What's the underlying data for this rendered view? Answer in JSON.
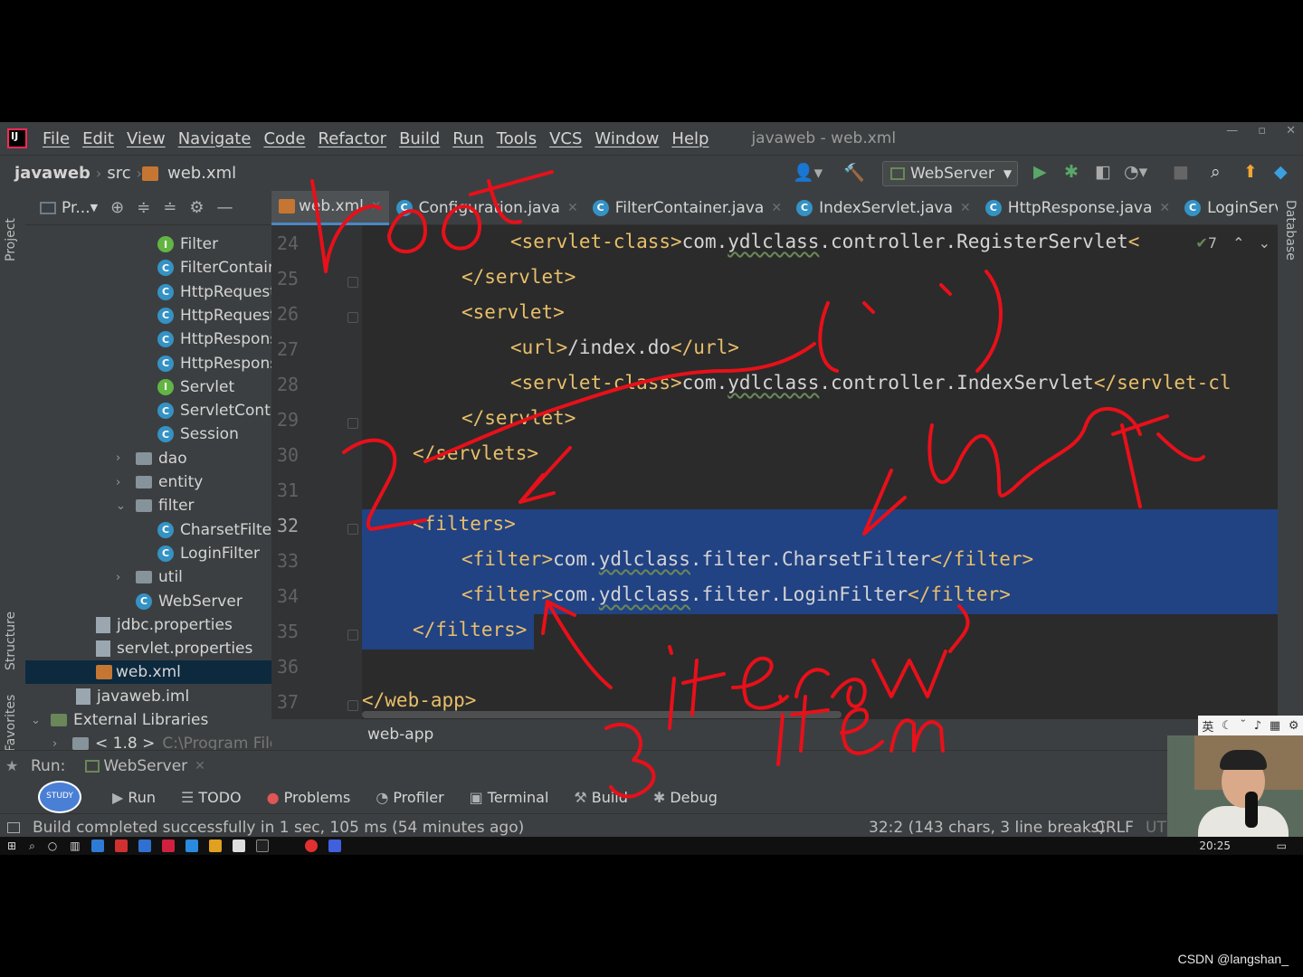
{
  "menubar": {
    "items": [
      "File",
      "Edit",
      "View",
      "Navigate",
      "Code",
      "Refactor",
      "Build",
      "Run",
      "Tools",
      "VCS",
      "Window",
      "Help"
    ],
    "title": "javaweb - web.xml"
  },
  "navbar": {
    "project": "javaweb",
    "src": "src",
    "file": "web.xml",
    "run_config": "WebServer"
  },
  "left_strip": {
    "project_tab": "Project",
    "structure_tab": "Structure",
    "favorites_tab": "Favorites"
  },
  "right_strip": {
    "database_tab": "Database"
  },
  "project_panel": {
    "title": "Pr...",
    "tree": [
      {
        "label": "Filter",
        "kind": "interface"
      },
      {
        "label": "FilterContain",
        "kind": "class"
      },
      {
        "label": "HttpRequest",
        "kind": "class"
      },
      {
        "label": "HttpRequest",
        "kind": "class"
      },
      {
        "label": "HttpRespons",
        "kind": "class"
      },
      {
        "label": "HttpRespons",
        "kind": "class"
      },
      {
        "label": "Servlet",
        "kind": "interface"
      },
      {
        "label": "ServletConta",
        "kind": "class"
      },
      {
        "label": "Session",
        "kind": "class"
      },
      {
        "label": "dao",
        "kind": "folder"
      },
      {
        "label": "entity",
        "kind": "folder"
      },
      {
        "label": "filter",
        "kind": "folder"
      },
      {
        "label": "CharsetFilter",
        "kind": "class"
      },
      {
        "label": "LoginFilter",
        "kind": "class"
      },
      {
        "label": "util",
        "kind": "folder"
      },
      {
        "label": "WebServer",
        "kind": "class"
      },
      {
        "label": "jdbc.properties",
        "kind": "file"
      },
      {
        "label": "servlet.properties",
        "kind": "file"
      },
      {
        "label": "web.xml",
        "kind": "xml"
      },
      {
        "label": "javaweb.iml",
        "kind": "file"
      },
      {
        "label": "External Libraries",
        "kind": "lib"
      },
      {
        "label": "< 1.8 >",
        "kind": "folder",
        "suffix": "C:\\Program Files"
      }
    ]
  },
  "editor_tabs": [
    {
      "label": "web.xml",
      "active": true
    },
    {
      "label": "Configuration.java",
      "active": false
    },
    {
      "label": "FilterContainer.java",
      "active": false
    },
    {
      "label": "IndexServlet.java",
      "active": false
    },
    {
      "label": "HttpResponse.java",
      "active": false
    },
    {
      "label": "LoginServlet.java",
      "active": false
    }
  ],
  "editor": {
    "inspection_count": "7",
    "line_numbers": [
      "24",
      "25",
      "26",
      "27",
      "28",
      "29",
      "30",
      "31",
      "32",
      "33",
      "34",
      "35",
      "36",
      "37"
    ],
    "current_line": "32",
    "lines": [
      {
        "tag_open": "<servlet-class>",
        "text": "com.",
        "wavy": "ydlclass",
        "rest": ".controller.RegisterServlet",
        "tag_close": "<"
      },
      {
        "tag_open": "</servlet>",
        "text": "",
        "wavy": "",
        "rest": "",
        "tag_close": ""
      },
      {
        "tag_open": "<servlet>",
        "text": "",
        "wavy": "",
        "rest": "",
        "tag_close": ""
      },
      {
        "tag_open": "<url>",
        "text": "/index.do",
        "wavy": "",
        "rest": "",
        "tag_close": "</url>"
      },
      {
        "tag_open": "<servlet-class>",
        "text": "com.",
        "wavy": "ydlclass",
        "rest": ".controller.IndexServlet",
        "tag_close": "</servlet-cl"
      },
      {
        "tag_open": "</servlet>",
        "text": "",
        "wavy": "",
        "rest": "",
        "tag_close": ""
      },
      {
        "tag_open": "</servlets>",
        "text": "",
        "wavy": "",
        "rest": "",
        "tag_close": ""
      },
      {
        "tag_open": "",
        "text": "",
        "wavy": "",
        "rest": "",
        "tag_close": ""
      },
      {
        "tag_open": "<filters>",
        "text": "",
        "wavy": "",
        "rest": "",
        "tag_close": ""
      },
      {
        "tag_open": "<filter>",
        "text": "com.",
        "wavy": "ydlclass",
        "rest": ".filter.CharsetFilter",
        "tag_close": "</filter>"
      },
      {
        "tag_open": "<filter>",
        "text": "com.",
        "wavy": "ydlclass",
        "rest": ".filter.LoginFilter",
        "tag_close": "</filter>"
      },
      {
        "tag_open": "</filters>",
        "text": "",
        "wavy": "",
        "rest": "",
        "tag_close": ""
      },
      {
        "tag_open": "",
        "text": "",
        "wavy": "",
        "rest": "",
        "tag_close": ""
      },
      {
        "tag_open": "</web-app>",
        "text": "",
        "wavy": "",
        "rest": "",
        "tag_close": ""
      }
    ],
    "breadcrumb": "web-app"
  },
  "run_header": {
    "label": "Run:",
    "config": "WebServer"
  },
  "bottom_tabs": [
    "Run",
    "TODO",
    "Problems",
    "Profiler",
    "Terminal",
    "Build",
    "Debug"
  ],
  "statusbar": {
    "message": "Build completed successfully in 1 sec, 105 ms (54 minutes ago)",
    "position": "32:2 (143 chars, 3 line breaks)",
    "line_sep": "CRLF",
    "encoding": "UTF"
  },
  "taskbar": {
    "time": "20:25"
  },
  "ime": "英",
  "annotations": {
    "root": "root",
    "element": "2 element(\" \")",
    "gettext": "getText",
    "iterator": "3 iterator",
    "item": "item"
  },
  "watermark": "CSDN @langshan_",
  "colors": {
    "annotation": "#e8101a",
    "selection": "#214283",
    "xml_tag": "#e8bf6a",
    "accent": "#4a88c7"
  }
}
